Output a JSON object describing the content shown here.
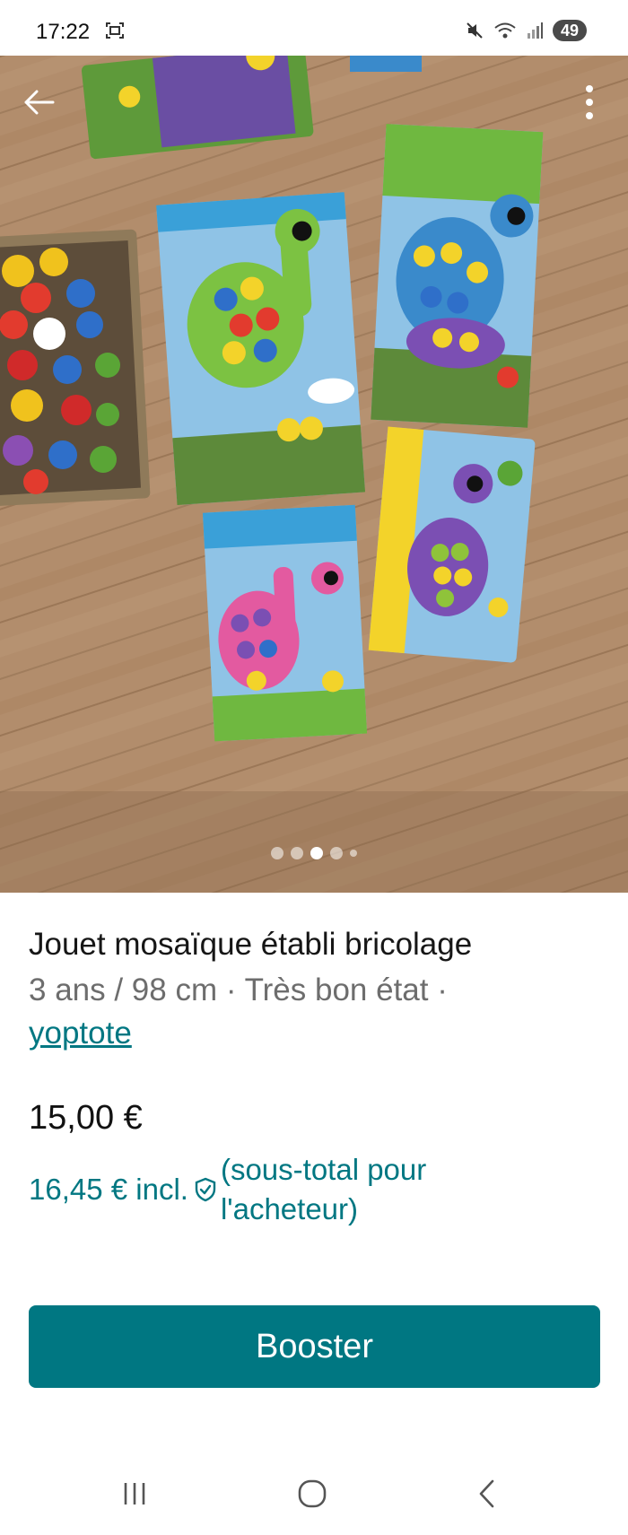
{
  "status_bar": {
    "time": "17:22",
    "battery": "49",
    "icons": [
      "screenshot-icon",
      "mute-icon",
      "wifi-icon",
      "signal-icon"
    ]
  },
  "photo": {
    "description_icons": [
      "back-arrow-icon",
      "more-vertical-icon"
    ],
    "carousel": {
      "count": 5,
      "active_index": 2
    }
  },
  "listing": {
    "title": "Jouet mosaïque établi bricolage",
    "meta": "3 ans / 98 cm · Très bon état ·",
    "seller": "yoptote",
    "price": "15,00 €",
    "buyer_price": "16,45 € incl.",
    "buyer_note": "(sous-total pour l'acheteur)"
  },
  "actions": {
    "booster_label": "Booster"
  },
  "colors": {
    "accent": "#007782",
    "floor": "#b08c6b"
  },
  "nav": [
    "recent-apps-icon",
    "home-icon",
    "back-icon"
  ]
}
